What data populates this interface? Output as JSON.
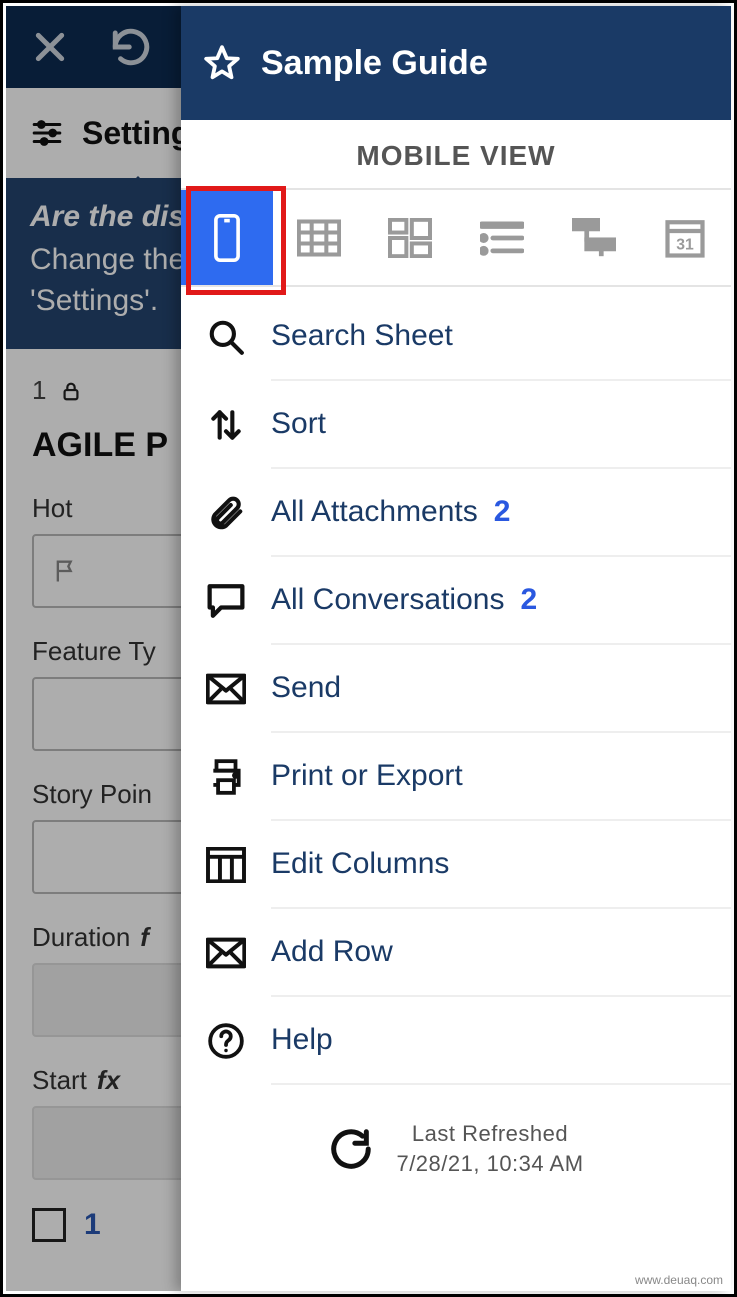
{
  "background": {
    "settings_label": "Settings",
    "hint_question": "Are the dis",
    "hint_answer_line1": "Change the",
    "hint_answer_line2": "'Settings'.",
    "row_number": "1",
    "sheet_title": "AGILE P",
    "fields": {
      "hot": "Hot",
      "feature_type": "Feature Ty",
      "story_points": "Story Poin",
      "duration": "Duration",
      "start": "Start"
    },
    "check_val": "1"
  },
  "panel": {
    "title": "Sample Guide",
    "view_label": "MOBILE VIEW",
    "view_icons": [
      "mobile",
      "grid",
      "card",
      "list",
      "gantt",
      "calendar"
    ],
    "menu": [
      {
        "icon": "search",
        "label": "Search Sheet"
      },
      {
        "icon": "sort",
        "label": "Sort"
      },
      {
        "icon": "attachment",
        "label": "All Attachments",
        "badge": "2"
      },
      {
        "icon": "conversation",
        "label": "All Conversations",
        "badge": "2"
      },
      {
        "icon": "send",
        "label": "Send"
      },
      {
        "icon": "print",
        "label": "Print or Export"
      },
      {
        "icon": "columns",
        "label": "Edit Columns"
      },
      {
        "icon": "addrow",
        "label": "Add Row"
      },
      {
        "icon": "help",
        "label": "Help"
      }
    ],
    "refresh": {
      "line1": "Last Refreshed",
      "line2": "7/28/21, 10:34 AM"
    }
  },
  "watermark": "www.deuaq.com"
}
